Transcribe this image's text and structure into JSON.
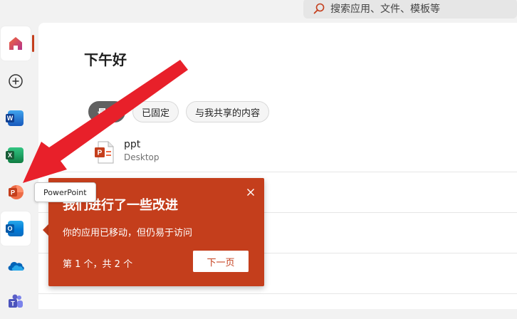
{
  "search": {
    "placeholder": "搜索应用、文件、模板等",
    "icon": "search-icon"
  },
  "sidebar": {
    "items": [
      {
        "name": "home",
        "icon": "home-icon"
      },
      {
        "name": "create",
        "icon": "plus-circle-icon"
      },
      {
        "name": "word",
        "icon": "word-icon",
        "color": "#185abd"
      },
      {
        "name": "excel",
        "icon": "excel-icon",
        "color": "#107c41"
      },
      {
        "name": "powerpoint",
        "icon": "powerpoint-icon",
        "color": "#c43e1c"
      },
      {
        "name": "outlook",
        "icon": "outlook-icon",
        "color": "#0f6cbd"
      },
      {
        "name": "onedrive",
        "icon": "onedrive-icon",
        "color": "#0364b8"
      },
      {
        "name": "teams",
        "icon": "teams-icon",
        "color": "#5b5fc7"
      }
    ],
    "tooltip": "PowerPoint"
  },
  "main": {
    "greeting": "下午好",
    "tabs": [
      {
        "label": "最近",
        "selected": true
      },
      {
        "label": "已固定",
        "selected": false
      },
      {
        "label": "与我共享的内容",
        "selected": false
      }
    ],
    "files": [
      {
        "name": "ppt",
        "location": "Desktop",
        "icon": "powerpoint-file-icon"
      }
    ]
  },
  "callout": {
    "title": "我们进行了一些改进",
    "body": "你的应用已移动，但仍易于访问",
    "page_indicator": "第 1 个，共 2 个",
    "next_label": "下一页",
    "close_icon": "close-icon"
  },
  "colors": {
    "accent": "#c43e1c",
    "arrow": "#e8202a"
  }
}
